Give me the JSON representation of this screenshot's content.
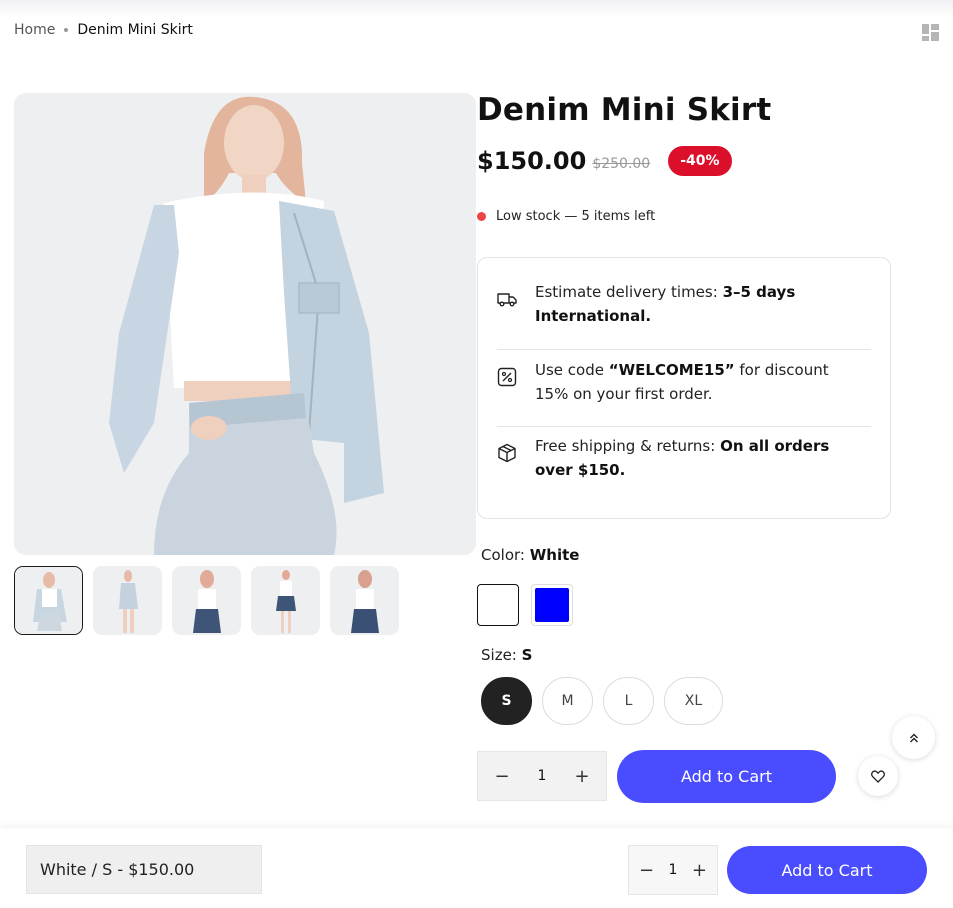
{
  "breadcrumb": {
    "home": "Home",
    "current": "Denim Mini Skirt"
  },
  "product": {
    "title": "Denim Mini Skirt",
    "price": "$150.00",
    "old_price": "$250.00",
    "discount_badge": "-40%",
    "stock_text": "Low stock — 5 items left"
  },
  "info": {
    "delivery": {
      "text": "Estimate delivery times: ",
      "bold": "3–5 days International.",
      "icon": "truck-icon"
    },
    "discount": {
      "pre": "Use code ",
      "code": "“WELCOME15”",
      "post": " for discount 15% on your first order.",
      "icon": "percent-icon"
    },
    "shipping": {
      "text": "Free shipping & returns: ",
      "bold": "On all orders over $150.",
      "icon": "box-icon"
    }
  },
  "color": {
    "label": "Color:",
    "selected": "White",
    "swatches": [
      {
        "name": "White",
        "hex": "#ffffff"
      },
      {
        "name": "Blue",
        "hex": "#0000ff"
      }
    ]
  },
  "size": {
    "label": "Size:",
    "selected": "S",
    "options": [
      "S",
      "M",
      "L",
      "XL"
    ]
  },
  "cart": {
    "quantity": "1",
    "minus": "−",
    "plus": "+",
    "add_label": "Add to Cart"
  },
  "sticky_bar": {
    "variant": "White / S - $150.00",
    "quantity": "1",
    "minus": "−",
    "plus": "+",
    "add_label": "Add to Cart"
  },
  "colors": {
    "accent": "#4a4cff",
    "sale": "#dc0f2b",
    "stock_dot": "#ef4444"
  }
}
